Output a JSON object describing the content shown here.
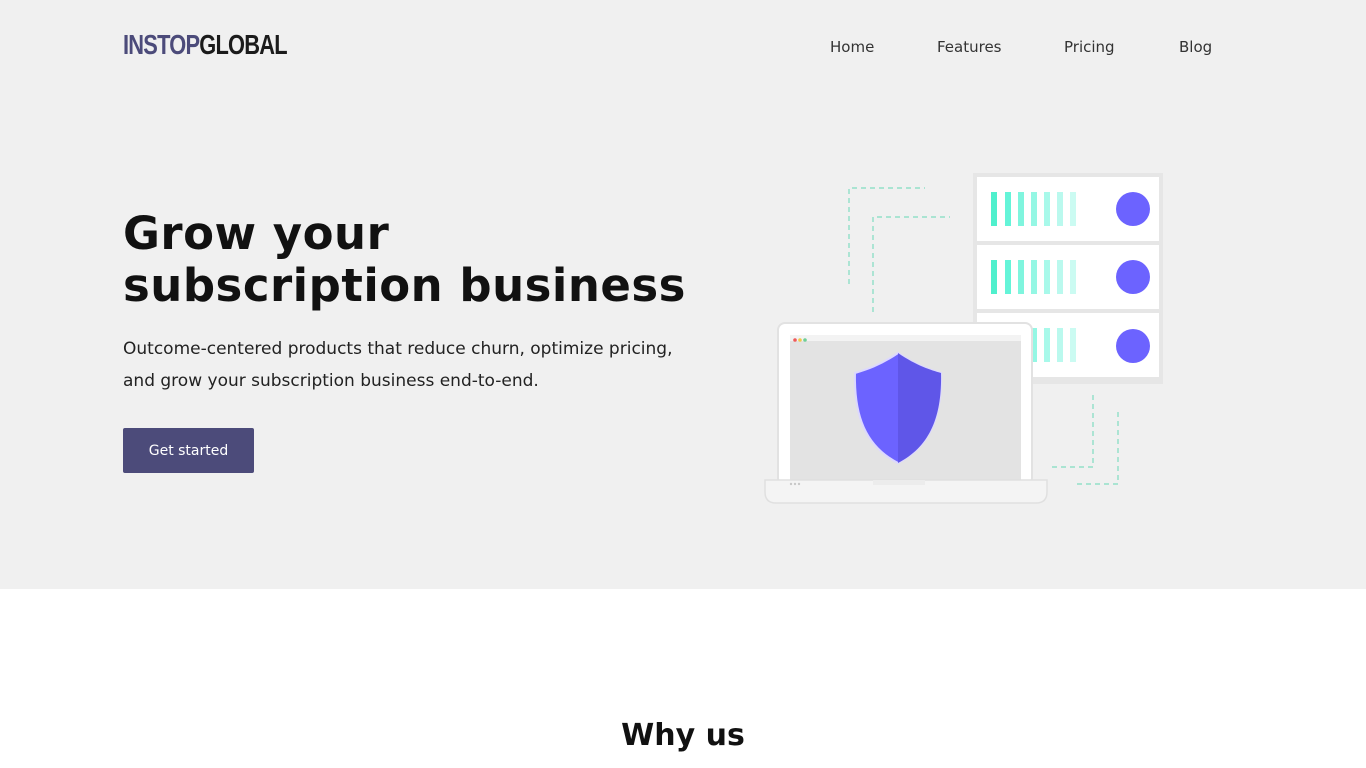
{
  "brand": {
    "logo_part1": "INSTOP",
    "logo_part2": "GLOBAL"
  },
  "nav": {
    "items": [
      {
        "label": "Home"
      },
      {
        "label": "Features"
      },
      {
        "label": "Pricing"
      },
      {
        "label": "Blog"
      }
    ]
  },
  "hero": {
    "headline_line1": "Grow your",
    "headline_line2": "subscription business",
    "subtext": "Outcome-centered products that reduce churn, optimize pricing, and grow your subscription business end-to-end.",
    "cta_label": "Get started",
    "illustration": "server-laptop-shield-illustration"
  },
  "section": {
    "title": "Why us"
  },
  "colors": {
    "brand_purple": "#4c4b7a",
    "hero_bg": "#f0f0f0",
    "accent_violet": "#6c63ff",
    "accent_teal": "#64f4d8"
  }
}
